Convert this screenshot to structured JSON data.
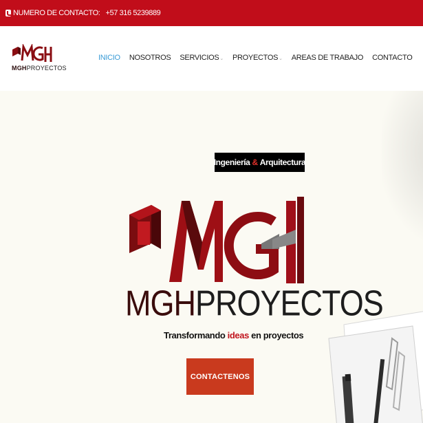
{
  "topbar": {
    "contact_label": "NUMERO DE CONTACTO:",
    "phone": "+57 316 5239889"
  },
  "logo": {
    "mark_text": "MGH",
    "sub_bold": "MGH",
    "sub_rest": "PROYECTOS"
  },
  "nav": {
    "items": [
      {
        "label": "INICIO",
        "active": true
      },
      {
        "label": "NOSOTROS"
      },
      {
        "label": "SERVICIOS",
        "has_dropdown": true
      },
      {
        "label": "PROYECTOS",
        "has_dropdown": true
      },
      {
        "label": "AREAS DE TRABAJO"
      },
      {
        "label": "CONTACTO"
      }
    ]
  },
  "hero": {
    "badge_left": "Ingeniería",
    "badge_amp": "&",
    "badge_right": "Arquitectura",
    "brand_mgh": "MGH",
    "brand_proyectos": "PROYECTOS",
    "slogan_pre": "Transformando",
    "slogan_highlight": "ideas",
    "slogan_post": "en proyectos",
    "cta_label": "CONTACTENOS"
  },
  "colors": {
    "brand_red": "#c10d1a",
    "active_link": "#3a9bd6",
    "cta": "#c93a1e",
    "hero_bg": "#fbfaf3"
  }
}
